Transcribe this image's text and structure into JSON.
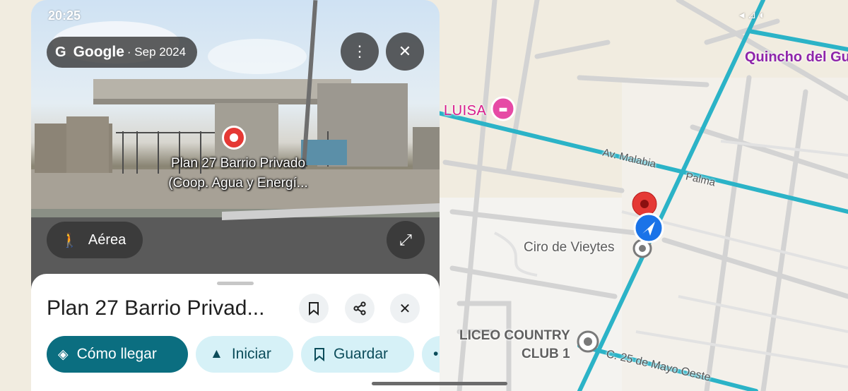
{
  "status_bar": {
    "time": "20:25",
    "right": "◂ ⊿ ◐"
  },
  "street_view": {
    "brand_letter": "G",
    "brand": "Google",
    "date": "· Sep 2024",
    "more_icon": "more-vertical-icon",
    "close_icon": "close-icon",
    "place_label_line1": "Plan 27 Barrio Privado",
    "place_label_line2": "(Coop. Agua y Energí...",
    "aerial_label": "Aérea",
    "expand_icon": "expand-icon"
  },
  "sheet": {
    "title": "Plan 27 Barrio Privad...",
    "actions": {
      "directions": "Cómo llegar",
      "start": "Iniciar",
      "save": "Guardar"
    }
  },
  "map": {
    "labels": {
      "quincho": "Quincho del Gu",
      "luisa": "LUISA",
      "malabia": "Av. Malabia",
      "palma": "Palma",
      "ciro": "Ciro de Vieytes",
      "liceo_line1": "LICEO COUNTRY",
      "liceo_line2": "CLUB 1",
      "mayo": "C. 25 de Mayo Oeste"
    },
    "colors": {
      "main_road": "#2bb3c7",
      "land": "#f1ece0",
      "pin": "#e53935",
      "nav_arrow": "#1a73e8"
    }
  }
}
